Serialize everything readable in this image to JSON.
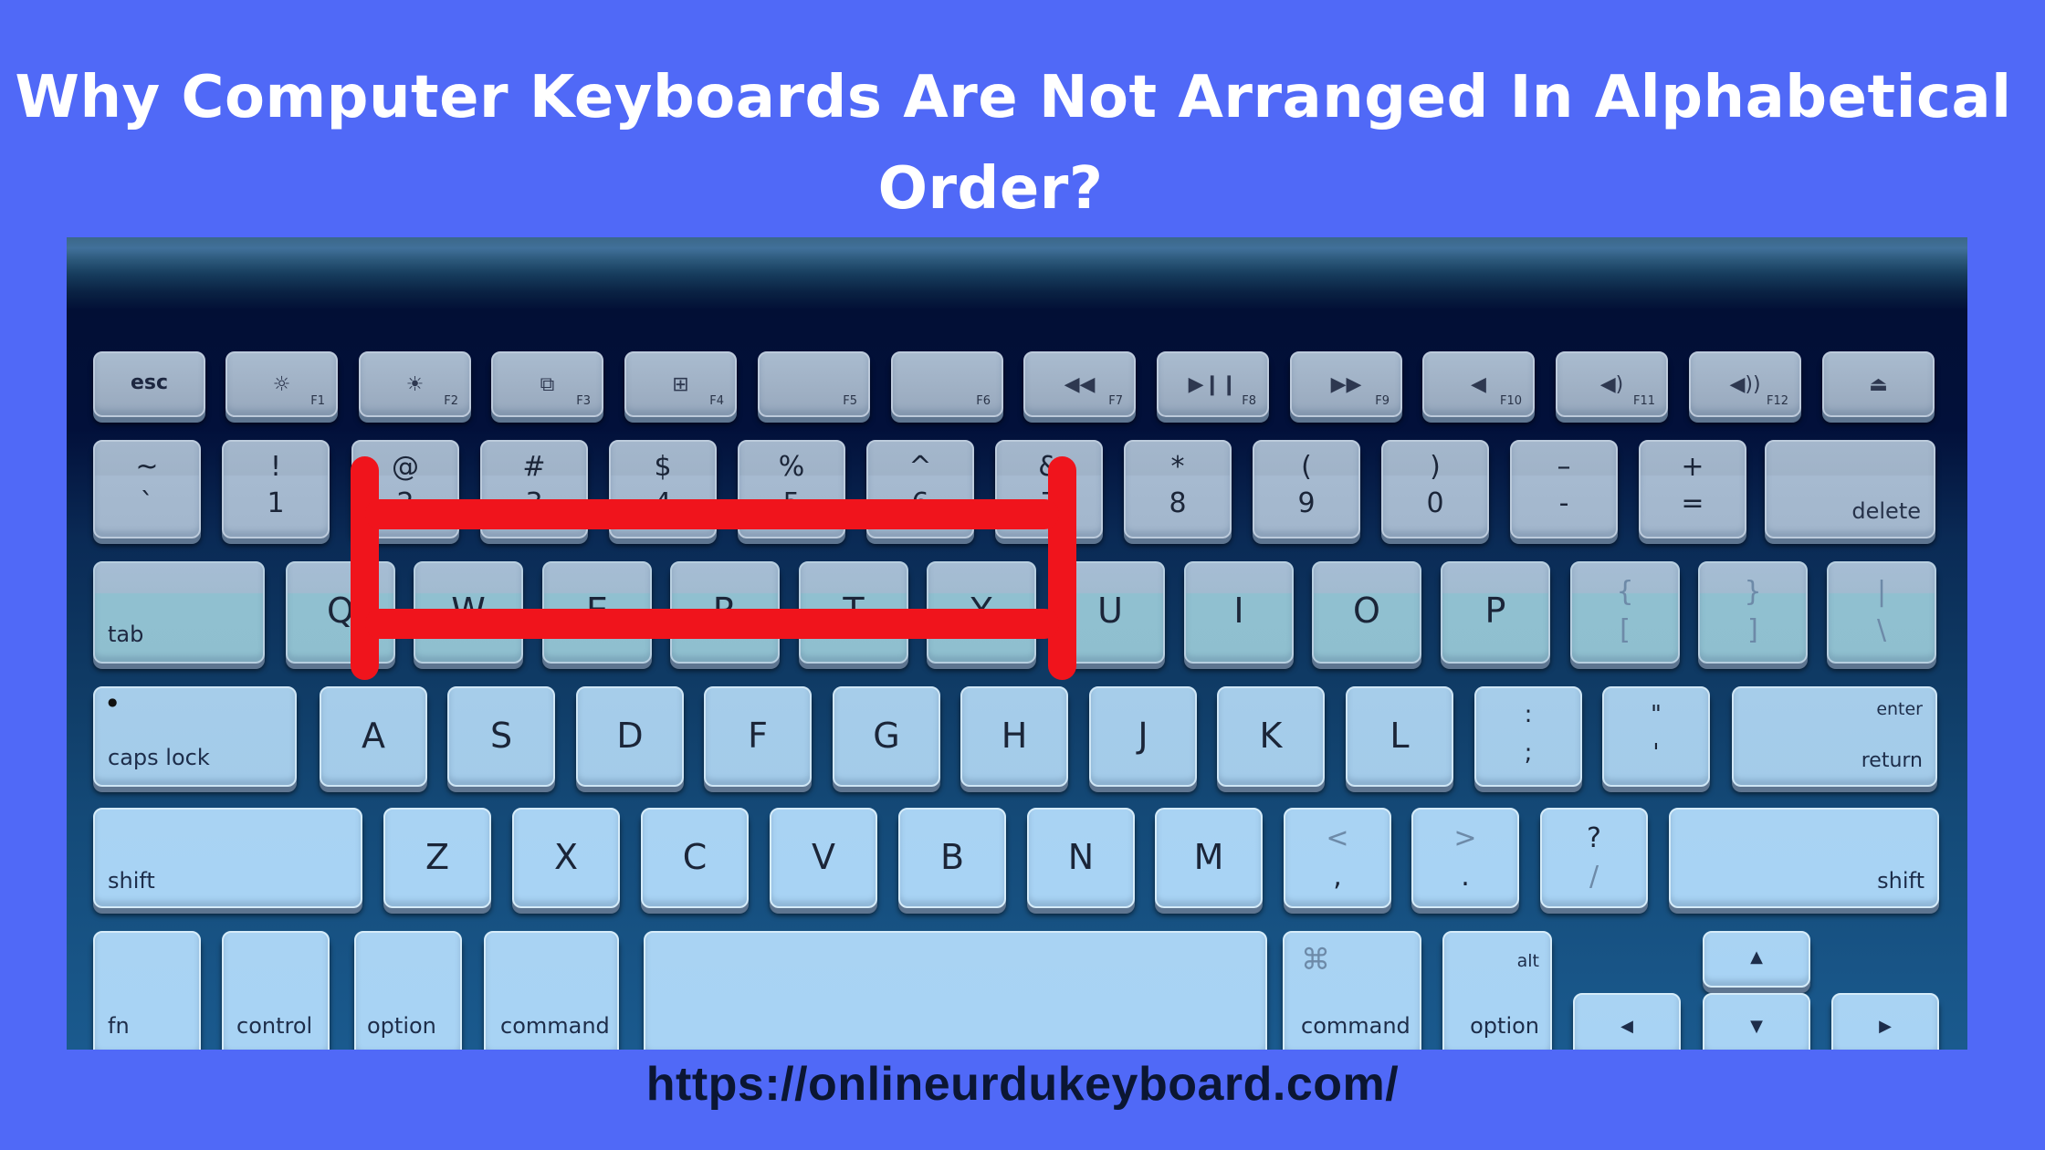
{
  "title": {
    "line1": "Why Computer Keyboards Are Not Arranged In Alphabetical",
    "line2": "Order?"
  },
  "keyboard": {
    "function_row": [
      {
        "main": "esc",
        "sub": ""
      },
      {
        "icon": "☼",
        "sub": "F1"
      },
      {
        "icon": "☀",
        "sub": "F2"
      },
      {
        "icon": "⧉",
        "sub": "F3"
      },
      {
        "icon": "⊞",
        "sub": "F4"
      },
      {
        "icon": "",
        "sub": "F5"
      },
      {
        "icon": "",
        "sub": "F6"
      },
      {
        "icon": "◀◀",
        "sub": "F7"
      },
      {
        "icon": "▶❙❙",
        "sub": "F8"
      },
      {
        "icon": "▶▶",
        "sub": "F9"
      },
      {
        "icon": "◀",
        "sub": "F10"
      },
      {
        "icon": "◀)",
        "sub": "F11"
      },
      {
        "icon": "◀))",
        "sub": "F12"
      },
      {
        "icon": "⏏",
        "sub": ""
      }
    ],
    "number_row": [
      {
        "top": "~",
        "bottom": "`"
      },
      {
        "top": "!",
        "bottom": "1"
      },
      {
        "top": "@",
        "bottom": "2"
      },
      {
        "top": "#",
        "bottom": "3"
      },
      {
        "top": "$",
        "bottom": "4"
      },
      {
        "top": "%",
        "bottom": "5"
      },
      {
        "top": "^",
        "bottom": "6"
      },
      {
        "top": "&",
        "bottom": "7"
      },
      {
        "top": "*",
        "bottom": "8"
      },
      {
        "top": "(",
        "bottom": "9"
      },
      {
        "top": ")",
        "bottom": "0"
      },
      {
        "top": "–",
        "bottom": "-"
      },
      {
        "top": "+",
        "bottom": "="
      },
      {
        "label": "delete"
      }
    ],
    "qwerty_row": {
      "tab": "tab",
      "letters": [
        "Q",
        "W",
        "E",
        "R",
        "T",
        "Y",
        "U",
        "I",
        "O",
        "P"
      ],
      "symbols": [
        {
          "top": "{",
          "bottom": "["
        },
        {
          "top": "}",
          "bottom": "]"
        },
        {
          "top": "|",
          "bottom": "\\"
        }
      ]
    },
    "home_row": {
      "caps": "caps lock",
      "letters": [
        "A",
        "S",
        "D",
        "F",
        "G",
        "H",
        "J",
        "K",
        "L"
      ],
      "symbols": [
        {
          "top": ":",
          "bottom": ";"
        },
        {
          "top": "\"",
          "bottom": "'"
        }
      ],
      "enter": "enter",
      "return": "return"
    },
    "shift_row": {
      "shift_left": "shift",
      "letters": [
        "Z",
        "X",
        "C",
        "V",
        "B",
        "N",
        "M"
      ],
      "symbols": [
        {
          "top": "<",
          "bottom": ","
        },
        {
          "top": ">",
          "bottom": "."
        },
        {
          "top": "?",
          "bottom": "/"
        }
      ],
      "shift_right": "shift"
    },
    "bottom_row": {
      "fn": "fn",
      "control": "control",
      "option_left": "option",
      "command_left": "command",
      "command_symbol": "⌘",
      "command_right": "command",
      "alt": "alt",
      "option_right": "option",
      "arrow_up": "▲",
      "arrow_down": "▼",
      "arrow_left": "◀",
      "arrow_right": "▶"
    }
  },
  "annotation": {
    "color": "#f0141c",
    "description": "red bracket highlighting the QWERTY keys"
  },
  "footer": {
    "url": "https://onlineurdukeyboard.com/"
  },
  "colors": {
    "background": "#5069f7",
    "title_text": "#ffffff",
    "url_text": "#0b1633"
  }
}
